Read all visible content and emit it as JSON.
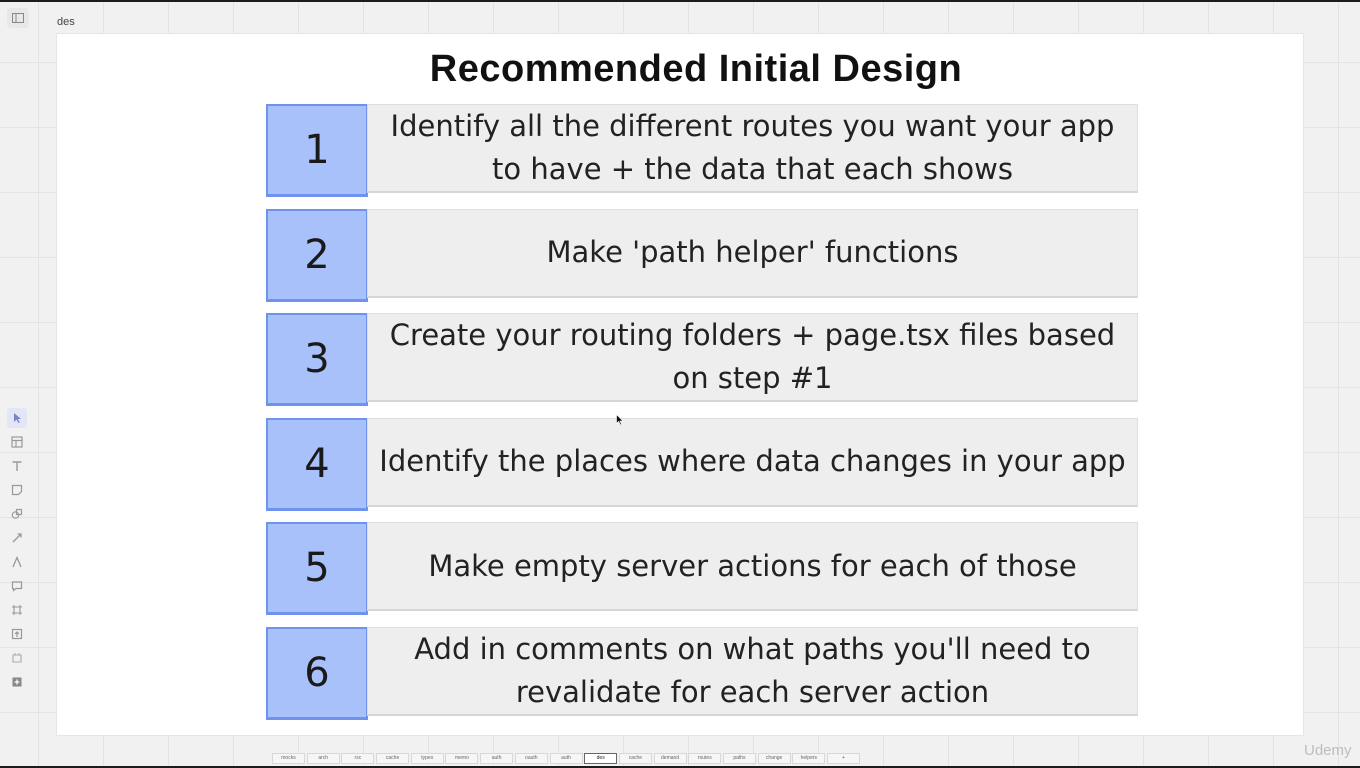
{
  "frame": {
    "label": "des"
  },
  "slide": {
    "title": "Recommended Initial Design",
    "steps": [
      {
        "number": "1",
        "text": "Identify all the different routes you want your app to have + the data that each shows"
      },
      {
        "number": "2",
        "text": "Make 'path helper' functions"
      },
      {
        "number": "3",
        "text": "Create your routing folders + page.tsx files based on step #1"
      },
      {
        "number": "4",
        "text": "Identify the places where data changes in your app"
      },
      {
        "number": "5",
        "text": "Make empty server actions for each of those"
      },
      {
        "number": "6",
        "text": "Add in comments on what paths you'll need to revalidate for each server action"
      }
    ]
  },
  "toolbar": {
    "tools": [
      "select-icon",
      "template-icon",
      "text-icon",
      "sticky-note-icon",
      "shapes-icon",
      "connector-icon",
      "pen-icon",
      "comment-icon",
      "frame-icon",
      "upload-icon",
      "more-icon",
      "apps-icon"
    ]
  },
  "tabs": {
    "items": [
      "mocks",
      "arch",
      "rsc",
      "cache",
      "types",
      "memo",
      "auth",
      "oauth",
      "auth",
      "des",
      "cache",
      "demand",
      "routes",
      "paths",
      "change",
      "helpers",
      "+"
    ],
    "active": "des"
  },
  "watermark": "Udemy",
  "colors": {
    "number_box": "#a9c1fa",
    "number_border": "#6f93ec",
    "text_box": "#eeeeef"
  }
}
